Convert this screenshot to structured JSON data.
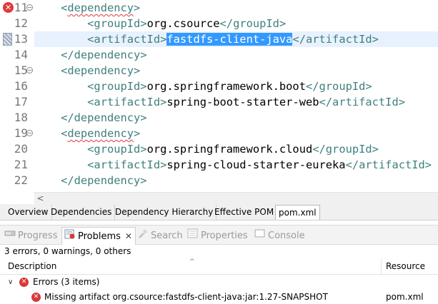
{
  "editor": {
    "lines": [
      {
        "num": "11",
        "indent": "    ",
        "tag": "dependency",
        "kind": "open",
        "error_marker": true,
        "fold": true,
        "squiggle": true
      },
      {
        "num": "12",
        "indent": "        ",
        "tag": "groupId",
        "kind": "element",
        "text": "org.csource"
      },
      {
        "num": "13",
        "indent": "        ",
        "tag": "artifactId",
        "kind": "element",
        "text": "fastdfs-client-java",
        "selected": true,
        "current": true,
        "occurrence_marker": true
      },
      {
        "num": "14",
        "indent": "    ",
        "tag": "dependency",
        "kind": "close"
      },
      {
        "num": "15",
        "indent": "    ",
        "tag": "dependency",
        "kind": "open",
        "fold": true
      },
      {
        "num": "16",
        "indent": "        ",
        "tag": "groupId",
        "kind": "element",
        "text": "org.springframework.boot"
      },
      {
        "num": "17",
        "indent": "        ",
        "tag": "artifactId",
        "kind": "element",
        "text": "spring-boot-starter-web"
      },
      {
        "num": "18",
        "indent": "    ",
        "tag": "dependency",
        "kind": "close"
      },
      {
        "num": "19",
        "indent": "    ",
        "tag": "dependency",
        "kind": "open",
        "fold": true,
        "squiggle": true
      },
      {
        "num": "20",
        "indent": "        ",
        "tag": "groupId",
        "kind": "element",
        "text": "org.springframework.cloud"
      },
      {
        "num": "21",
        "indent": "        ",
        "tag": "artifactId",
        "kind": "element",
        "text": "spring-cloud-starter-eureka"
      },
      {
        "num": "22",
        "indent": "    ",
        "tag": "dependency",
        "kind": "close"
      }
    ]
  },
  "pom_tabs": [
    "Overview",
    "Dependencies",
    "Dependency Hierarchy",
    "Effective POM",
    "pom.xml"
  ],
  "pom_tabs_active_index": 4,
  "views": {
    "tabs": [
      {
        "label": "Progress",
        "icon": "progress-icon",
        "active": false
      },
      {
        "label": "Problems",
        "icon": "problems-icon",
        "active": true,
        "close": "✕"
      },
      {
        "label": "Search",
        "icon": "search-icon",
        "active": false
      },
      {
        "label": "Properties",
        "icon": "properties-icon",
        "active": false
      },
      {
        "label": "Console",
        "icon": "console-icon",
        "active": false
      }
    ]
  },
  "problems": {
    "summary": "3 errors, 0 warnings, 0 others",
    "columns": {
      "description": "Description",
      "resource": "Resource"
    },
    "group": {
      "label": "Errors (3 items)",
      "expanded": true
    },
    "items": [
      {
        "description": "Missing artifact org.csource:fastdfs-client-java:jar:1.27-SNAPSHOT",
        "resource": "pom.xml"
      }
    ]
  },
  "colors": {
    "tag": "#3f7f7f",
    "selection": "#3399ff",
    "current_line": "#e8f2fe",
    "error": "#e0393a"
  }
}
